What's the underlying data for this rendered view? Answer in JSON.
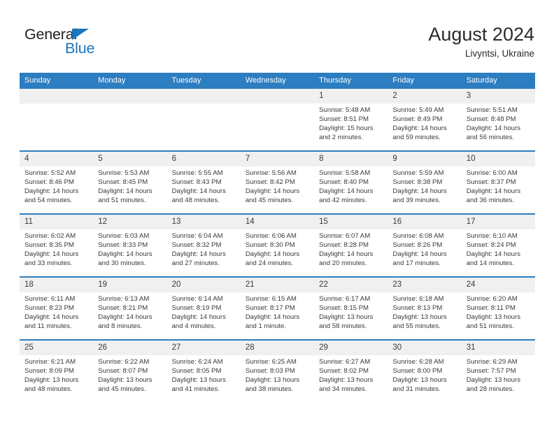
{
  "brand": {
    "name_top": "General",
    "name_bottom": "Blue",
    "accent_color": "#1b75bb"
  },
  "header": {
    "title": "August 2024",
    "location": "Livyntsi, Ukraine"
  },
  "theme": {
    "header_blue": "#2d7dc1",
    "daynum_band": "#f0f0f0",
    "text": "#3a3a3a"
  },
  "weekdays": [
    "Sunday",
    "Monday",
    "Tuesday",
    "Wednesday",
    "Thursday",
    "Friday",
    "Saturday"
  ],
  "labels": {
    "sunrise": "Sunrise:",
    "sunset": "Sunset:",
    "daylight": "Daylight:"
  },
  "weeks": [
    [
      {
        "day": "",
        "empty": true
      },
      {
        "day": "",
        "empty": true
      },
      {
        "day": "",
        "empty": true
      },
      {
        "day": "",
        "empty": true
      },
      {
        "day": "1",
        "sunrise": "Sunrise: 5:48 AM",
        "sunset": "Sunset: 8:51 PM",
        "daylight": "Daylight: 15 hours and 2 minutes."
      },
      {
        "day": "2",
        "sunrise": "Sunrise: 5:49 AM",
        "sunset": "Sunset: 8:49 PM",
        "daylight": "Daylight: 14 hours and 59 minutes."
      },
      {
        "day": "3",
        "sunrise": "Sunrise: 5:51 AM",
        "sunset": "Sunset: 8:48 PM",
        "daylight": "Daylight: 14 hours and 56 minutes."
      }
    ],
    [
      {
        "day": "4",
        "sunrise": "Sunrise: 5:52 AM",
        "sunset": "Sunset: 8:46 PM",
        "daylight": "Daylight: 14 hours and 54 minutes."
      },
      {
        "day": "5",
        "sunrise": "Sunrise: 5:53 AM",
        "sunset": "Sunset: 8:45 PM",
        "daylight": "Daylight: 14 hours and 51 minutes."
      },
      {
        "day": "6",
        "sunrise": "Sunrise: 5:55 AM",
        "sunset": "Sunset: 8:43 PM",
        "daylight": "Daylight: 14 hours and 48 minutes."
      },
      {
        "day": "7",
        "sunrise": "Sunrise: 5:56 AM",
        "sunset": "Sunset: 8:42 PM",
        "daylight": "Daylight: 14 hours and 45 minutes."
      },
      {
        "day": "8",
        "sunrise": "Sunrise: 5:58 AM",
        "sunset": "Sunset: 8:40 PM",
        "daylight": "Daylight: 14 hours and 42 minutes."
      },
      {
        "day": "9",
        "sunrise": "Sunrise: 5:59 AM",
        "sunset": "Sunset: 8:38 PM",
        "daylight": "Daylight: 14 hours and 39 minutes."
      },
      {
        "day": "10",
        "sunrise": "Sunrise: 6:00 AM",
        "sunset": "Sunset: 8:37 PM",
        "daylight": "Daylight: 14 hours and 36 minutes."
      }
    ],
    [
      {
        "day": "11",
        "sunrise": "Sunrise: 6:02 AM",
        "sunset": "Sunset: 8:35 PM",
        "daylight": "Daylight: 14 hours and 33 minutes."
      },
      {
        "day": "12",
        "sunrise": "Sunrise: 6:03 AM",
        "sunset": "Sunset: 8:33 PM",
        "daylight": "Daylight: 14 hours and 30 minutes."
      },
      {
        "day": "13",
        "sunrise": "Sunrise: 6:04 AM",
        "sunset": "Sunset: 8:32 PM",
        "daylight": "Daylight: 14 hours and 27 minutes."
      },
      {
        "day": "14",
        "sunrise": "Sunrise: 6:06 AM",
        "sunset": "Sunset: 8:30 PM",
        "daylight": "Daylight: 14 hours and 24 minutes."
      },
      {
        "day": "15",
        "sunrise": "Sunrise: 6:07 AM",
        "sunset": "Sunset: 8:28 PM",
        "daylight": "Daylight: 14 hours and 20 minutes."
      },
      {
        "day": "16",
        "sunrise": "Sunrise: 6:08 AM",
        "sunset": "Sunset: 8:26 PM",
        "daylight": "Daylight: 14 hours and 17 minutes."
      },
      {
        "day": "17",
        "sunrise": "Sunrise: 6:10 AM",
        "sunset": "Sunset: 8:24 PM",
        "daylight": "Daylight: 14 hours and 14 minutes."
      }
    ],
    [
      {
        "day": "18",
        "sunrise": "Sunrise: 6:11 AM",
        "sunset": "Sunset: 8:23 PM",
        "daylight": "Daylight: 14 hours and 11 minutes."
      },
      {
        "day": "19",
        "sunrise": "Sunrise: 6:13 AM",
        "sunset": "Sunset: 8:21 PM",
        "daylight": "Daylight: 14 hours and 8 minutes."
      },
      {
        "day": "20",
        "sunrise": "Sunrise: 6:14 AM",
        "sunset": "Sunset: 8:19 PM",
        "daylight": "Daylight: 14 hours and 4 minutes."
      },
      {
        "day": "21",
        "sunrise": "Sunrise: 6:15 AM",
        "sunset": "Sunset: 8:17 PM",
        "daylight": "Daylight: 14 hours and 1 minute."
      },
      {
        "day": "22",
        "sunrise": "Sunrise: 6:17 AM",
        "sunset": "Sunset: 8:15 PM",
        "daylight": "Daylight: 13 hours and 58 minutes."
      },
      {
        "day": "23",
        "sunrise": "Sunrise: 6:18 AM",
        "sunset": "Sunset: 8:13 PM",
        "daylight": "Daylight: 13 hours and 55 minutes."
      },
      {
        "day": "24",
        "sunrise": "Sunrise: 6:20 AM",
        "sunset": "Sunset: 8:11 PM",
        "daylight": "Daylight: 13 hours and 51 minutes."
      }
    ],
    [
      {
        "day": "25",
        "sunrise": "Sunrise: 6:21 AM",
        "sunset": "Sunset: 8:09 PM",
        "daylight": "Daylight: 13 hours and 48 minutes."
      },
      {
        "day": "26",
        "sunrise": "Sunrise: 6:22 AM",
        "sunset": "Sunset: 8:07 PM",
        "daylight": "Daylight: 13 hours and 45 minutes."
      },
      {
        "day": "27",
        "sunrise": "Sunrise: 6:24 AM",
        "sunset": "Sunset: 8:05 PM",
        "daylight": "Daylight: 13 hours and 41 minutes."
      },
      {
        "day": "28",
        "sunrise": "Sunrise: 6:25 AM",
        "sunset": "Sunset: 8:03 PM",
        "daylight": "Daylight: 13 hours and 38 minutes."
      },
      {
        "day": "29",
        "sunrise": "Sunrise: 6:27 AM",
        "sunset": "Sunset: 8:02 PM",
        "daylight": "Daylight: 13 hours and 34 minutes."
      },
      {
        "day": "30",
        "sunrise": "Sunrise: 6:28 AM",
        "sunset": "Sunset: 8:00 PM",
        "daylight": "Daylight: 13 hours and 31 minutes."
      },
      {
        "day": "31",
        "sunrise": "Sunrise: 6:29 AM",
        "sunset": "Sunset: 7:57 PM",
        "daylight": "Daylight: 13 hours and 28 minutes."
      }
    ]
  ]
}
